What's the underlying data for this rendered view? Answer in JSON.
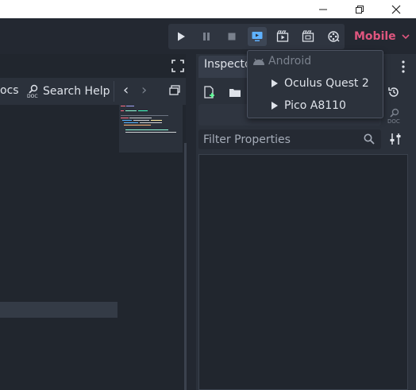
{
  "window": {
    "minimize_icon": "minimize-icon",
    "maximize_icon": "restore-icon",
    "close_icon": "close-icon"
  },
  "toolbar": {
    "buttons": [
      "play-icon",
      "pause-icon",
      "stop-icon",
      "remote-deploy-icon",
      "play-scene-icon",
      "play-custom-scene-icon",
      "movie-maker-icon"
    ],
    "renderer": "Mobile"
  },
  "left_toolbar": {
    "docs_label": "ocs",
    "search_help_label": "Search Help",
    "nav_back": "‹",
    "nav_forward": "›"
  },
  "inspector": {
    "tab_label": "Inspecto",
    "filter_placeholder": "Filter Properties"
  },
  "deploy_menu": {
    "platform": "Android",
    "devices": [
      "Oculus Quest 2",
      "Pico A8110"
    ]
  },
  "colors": {
    "accent": "#e0567f",
    "active_button": "#5fb2ff",
    "panel_bg": "#2b313b"
  }
}
